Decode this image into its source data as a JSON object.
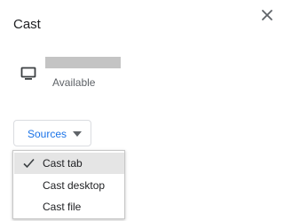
{
  "dialog": {
    "title": "Cast"
  },
  "close": {
    "icon": "close-icon"
  },
  "sink": {
    "icon": "tv-icon",
    "status": "Available"
  },
  "sources": {
    "label": "Sources",
    "accent_color": "#1a73e8"
  },
  "menu": {
    "items": [
      {
        "label": "Cast tab",
        "selected": true
      },
      {
        "label": "Cast desktop",
        "selected": false
      },
      {
        "label": "Cast file",
        "selected": false
      }
    ]
  }
}
